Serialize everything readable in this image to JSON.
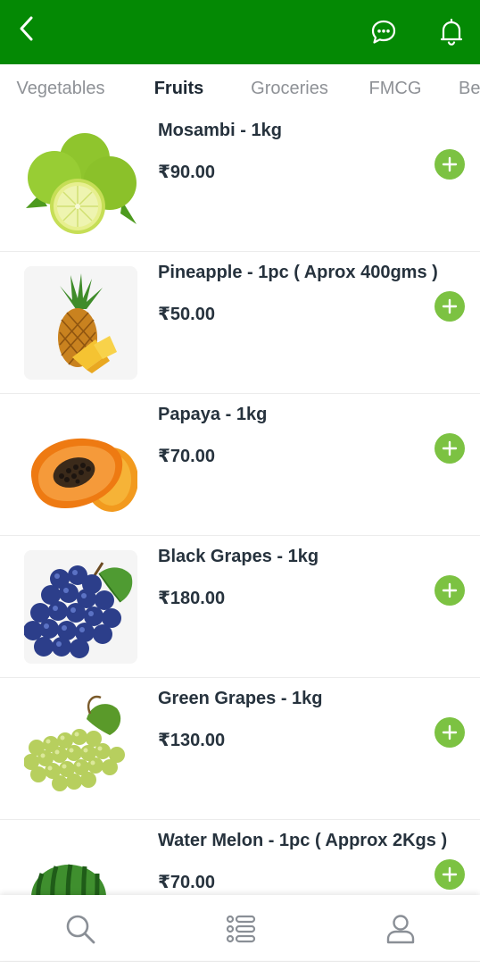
{
  "header": {
    "back_icon": "chevron-left-icon",
    "chat_icon": "chat-bubble-icon",
    "bell_icon": "bell-icon",
    "background_color": "#048904"
  },
  "tabs": [
    {
      "label": "Vegetables",
      "active": false
    },
    {
      "label": "Fruits",
      "active": true
    },
    {
      "label": "Groceries",
      "active": false
    },
    {
      "label": "FMCG",
      "active": false
    },
    {
      "label": "Be",
      "active": false
    }
  ],
  "products": [
    {
      "name": "Mosambi - 1kg",
      "price": "₹90.00",
      "image": "mosambi-image"
    },
    {
      "name": "Pineapple - 1pc ( Aprox 400gms )",
      "price": "₹50.00",
      "image": "pineapple-image"
    },
    {
      "name": "Papaya - 1kg",
      "price": "₹70.00",
      "image": "papaya-image"
    },
    {
      "name": "Black Grapes - 1kg",
      "price": "₹180.00",
      "image": "black-grapes-image"
    },
    {
      "name": "Green Grapes - 1kg",
      "price": "₹130.00",
      "image": "green-grapes-image"
    },
    {
      "name": "Water Melon - 1pc ( Approx 2Kgs )",
      "price": "₹70.00",
      "image": "watermelon-image"
    }
  ],
  "bottom_nav": {
    "items": [
      "search-icon",
      "list-icon",
      "user-icon"
    ]
  },
  "colors": {
    "accent_green": "#7cc242",
    "header_green": "#048904",
    "text_dark": "#26323d",
    "tab_inactive": "#8e9196"
  }
}
